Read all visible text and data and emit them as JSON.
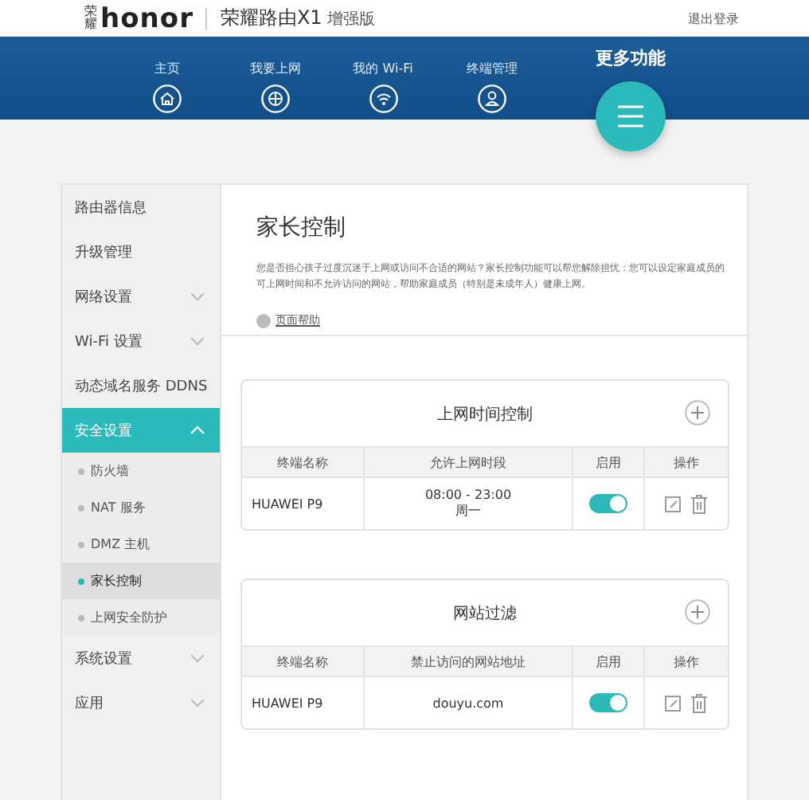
{
  "header": {
    "brand_mark": "荣耀",
    "logo": "honor",
    "product": "荣耀路由X1",
    "edition": "增强版",
    "logout": "退出登录"
  },
  "nav": [
    {
      "label": "主页",
      "kind": "home",
      "selected": false
    },
    {
      "label": "我要上网",
      "kind": "globe",
      "selected": false
    },
    {
      "label": "我的 Wi-Fi",
      "kind": "wifi",
      "selected": false
    },
    {
      "label": "终端管理",
      "kind": "user",
      "selected": false
    },
    {
      "label": "更多功能",
      "kind": "menu",
      "selected": true
    }
  ],
  "sidebar": {
    "items": [
      {
        "label": "路由器信息",
        "selected": false
      },
      {
        "label": "升级管理",
        "selected": false
      },
      {
        "label": "网络设置",
        "selected": false,
        "expanded": false
      },
      {
        "label": "Wi-Fi 设置",
        "selected": false,
        "expanded": false
      },
      {
        "label": "动态域名服务 DDNS",
        "selected": false
      },
      {
        "label": "安全设置",
        "selected": true,
        "expanded": true,
        "children": [
          {
            "label": "防火墙",
            "selected": false
          },
          {
            "label": "NAT 服务",
            "selected": false
          },
          {
            "label": "DMZ 主机",
            "selected": false
          },
          {
            "label": "家长控制",
            "selected": true
          },
          {
            "label": "上网安全防护",
            "selected": false
          }
        ]
      },
      {
        "label": "系统设置",
        "selected": false,
        "expanded": false
      },
      {
        "label": "应用",
        "selected": false,
        "expanded": false
      }
    ]
  },
  "page": {
    "title": "家长控制",
    "description": "您是否担心孩子过度沉迷于上网或访问不合适的网站？家长控制功能可以帮您解除担忧：您可以设定家庭成员的可上网时间和不允许访问的网站，帮助家庭成员（特别是未成年人）健康上网。",
    "help_link": "页面帮助"
  },
  "cards": [
    {
      "title": "上网时间控制",
      "columns": [
        "终端名称",
        "允许上网时段",
        "启用",
        "操作"
      ],
      "rows": [
        {
          "device": "HUAWEI P9",
          "rule_lines": [
            "08:00 - 23:00",
            "周一"
          ],
          "enabled": true
        }
      ]
    },
    {
      "title": "网站过滤",
      "columns": [
        "终端名称",
        "禁止访问的网站地址",
        "启用",
        "操作"
      ],
      "rows": [
        {
          "device": "HUAWEI P9",
          "rule_lines": [
            "douyu.com"
          ],
          "enabled": true
        }
      ]
    }
  ]
}
